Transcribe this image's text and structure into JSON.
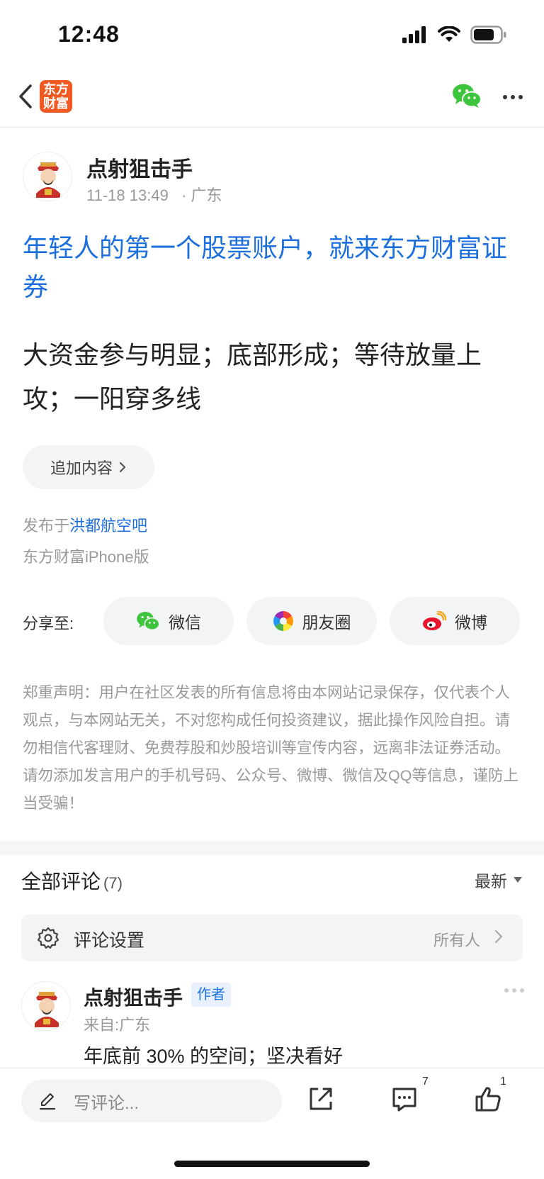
{
  "status_bar": {
    "time": "12:48"
  },
  "nav": {
    "logo_text": "东方财富"
  },
  "post": {
    "author": "点射狙击手",
    "date": "11-18 13:49",
    "location": "· 广东",
    "title": "年轻人的第一个股票账户，就来东方财富证券",
    "body": "大资金参与明显；底部形成；等待放量上攻；一阳穿多线",
    "append_label": "追加内容",
    "posted_in_prefix": "发布于",
    "forum": "洪都航空吧",
    "client": "东方财富iPhone版"
  },
  "share": {
    "label": "分享至:",
    "items": [
      {
        "label": "微信",
        "icon": "wechat-icon"
      },
      {
        "label": "朋友圈",
        "icon": "moments-icon"
      },
      {
        "label": "微博",
        "icon": "weibo-icon"
      }
    ]
  },
  "disclaimer": "郑重声明：用户在社区发表的所有信息将由本网站记录保存，仅代表个人观点，与本网站无关，不对您构成任何投资建议，据此操作风险自担。请勿相信代客理财、免费荐股和炒股培训等宣传内容，远离非法证券活动。请勿添加发言用户的手机号码、公众号、微博、微信及QQ等信息，谨防上当受骗！",
  "comments": {
    "title": "全部评论",
    "count": "(7)",
    "sort": "最新",
    "settings_label": "评论设置",
    "settings_value": "所有人",
    "items": [
      {
        "author": "点射狙击手",
        "badge": "作者",
        "from": "来自:广东",
        "text": "年底前 30% 的空间；坚决看好"
      }
    ]
  },
  "toolbar": {
    "input_placeholder": "写评论...",
    "comment_count": "7",
    "like_count": "1"
  },
  "colors": {
    "accent": "#1d6fde",
    "brand": "#f05a22",
    "wechat": "#3ec53e"
  }
}
